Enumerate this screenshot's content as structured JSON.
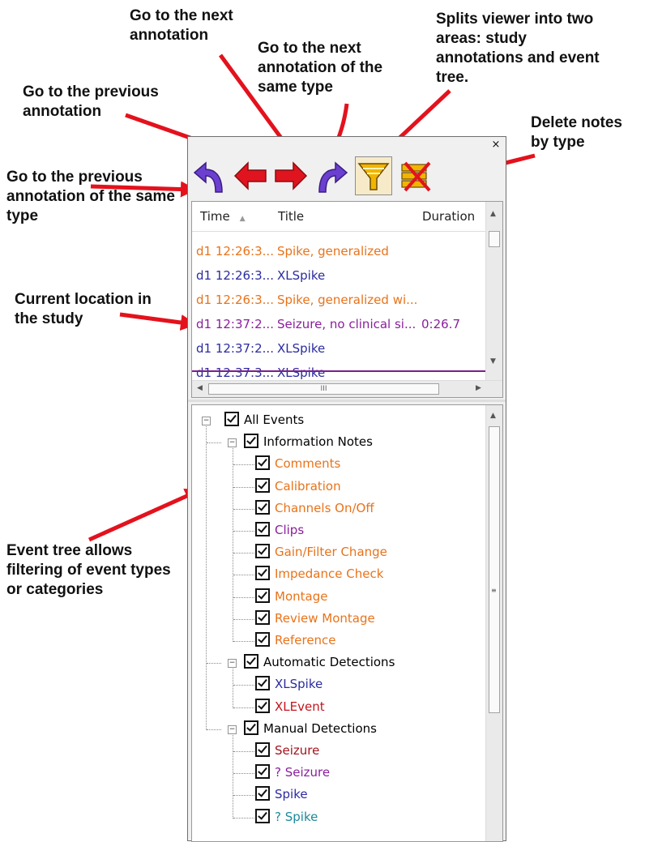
{
  "callouts": {
    "prev_same_type": "Go to the previous annotation of the same type",
    "prev": "Go to the previous annotation",
    "next": "Go to the next annotation",
    "next_same_type": "Go to the next annotation of the same type",
    "split": "Splits viewer into two areas: study annotations and event tree.",
    "delete": "Delete notes by type",
    "current": "Current location in the study",
    "tree": "Event tree allows filtering of event types or categories"
  },
  "window": {
    "close_label": "×"
  },
  "toolbar": {
    "buttons": [
      {
        "name": "prev-same-type",
        "icon": "curved-arrow-left-icon",
        "color": "#6b3fcf"
      },
      {
        "name": "prev-annotation",
        "icon": "arrow-left-icon",
        "color": "#e0141e"
      },
      {
        "name": "next-annotation",
        "icon": "arrow-right-icon",
        "color": "#e0141e"
      },
      {
        "name": "next-same-type",
        "icon": "curved-arrow-right-icon",
        "color": "#6b3fcf"
      },
      {
        "name": "split-viewer",
        "icon": "funnel-icon",
        "color": "#e5a100",
        "pressed": true
      },
      {
        "name": "delete-by-type",
        "icon": "delete-notes-icon",
        "color": "#e5a100"
      }
    ]
  },
  "list": {
    "columns": {
      "time": "Time",
      "title": "Title",
      "duration": "Duration"
    },
    "rows": [
      {
        "time": "d1 12:26:3...",
        "title": "Spike, generalized",
        "duration": "",
        "color": "#e8731a"
      },
      {
        "time": "d1 12:26:3...",
        "title": "XLSpike",
        "duration": "",
        "color": "#2b2ba0"
      },
      {
        "time": "d1 12:26:3...",
        "title": "Spike, generalized wi...",
        "duration": "",
        "color": "#e8731a"
      },
      {
        "time": "d1 12:37:2...",
        "title": "Seizure, no clinical si...",
        "duration": "0:26.7",
        "color": "#8a1f9c"
      },
      {
        "time": "d1 12:37:2...",
        "title": "XLSpike",
        "duration": "",
        "color": "#2b2ba0"
      },
      {
        "time": "d1 12:37:3...",
        "title": "XLSpike",
        "duration": "",
        "color": "#2b2ba0"
      }
    ],
    "hscroll_grip": "III"
  },
  "tree": {
    "root": "All Events",
    "groups": [
      {
        "label": "Information Notes",
        "items": [
          {
            "label": "Comments",
            "color": "#e8731a"
          },
          {
            "label": "Calibration",
            "color": "#e8731a"
          },
          {
            "label": "Channels On/Off",
            "color": "#e8731a"
          },
          {
            "label": "Clips",
            "color": "#8a1f9c"
          },
          {
            "label": "Gain/Filter Change",
            "color": "#e8731a"
          },
          {
            "label": "Impedance Check",
            "color": "#e8731a"
          },
          {
            "label": "Montage",
            "color": "#e8731a"
          },
          {
            "label": "Review Montage",
            "color": "#e8731a"
          },
          {
            "label": "Reference",
            "color": "#e8731a"
          }
        ]
      },
      {
        "label": "Automatic Detections",
        "items": [
          {
            "label": "XLSpike",
            "color": "#2b2ba0"
          },
          {
            "label": "XLEvent",
            "color": "#c3141c"
          }
        ]
      },
      {
        "label": "Manual Detections",
        "items": [
          {
            "label": "Seizure",
            "color": "#a0141c"
          },
          {
            "label": "? Seizure",
            "color": "#8a1f9c"
          },
          {
            "label": "Spike",
            "color": "#2b2ba0"
          },
          {
            "label": "? Spike",
            "color": "#1b8a9a"
          }
        ]
      }
    ]
  },
  "colors": {
    "annotation_arrow": "#e3121d",
    "current_line": "#7b1f8a"
  }
}
